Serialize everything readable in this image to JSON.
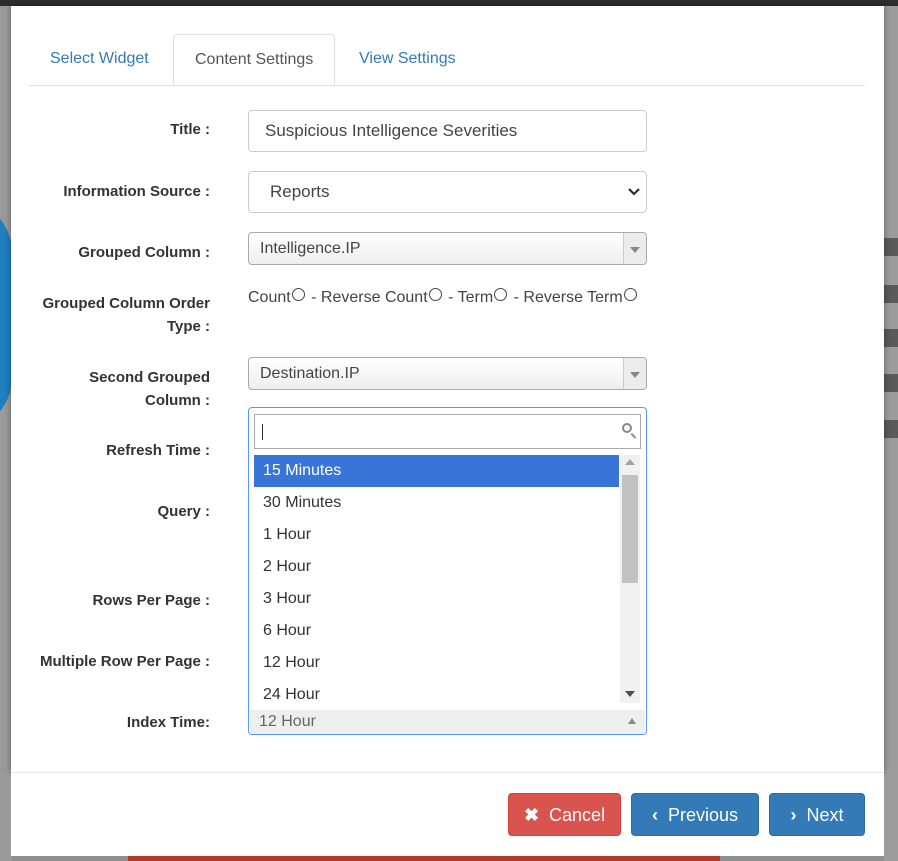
{
  "tabs": [
    "Select Widget",
    "Content Settings",
    "View Settings"
  ],
  "form": {
    "title_label": "Title :",
    "title_value": "Suspicious Intelligence Severities",
    "info_source_label": "Information Source :",
    "info_source_value": "Reports",
    "grouped_column_label": "Grouped Column :",
    "grouped_column_value": "Intelligence.IP",
    "order_type_label_1": "Grouped Column Order",
    "order_type_label_2": "Type :",
    "order_options": [
      "Count",
      "- Reverse Count",
      "- Term",
      "- Reverse Term"
    ],
    "second_grouped_label_1": "Second Grouped",
    "second_grouped_label_2": "Column :",
    "second_grouped_value": "Destination.IP",
    "refresh_time_label": "Refresh Time :",
    "query_label": "Query :",
    "rows_per_page_label": "Rows Per Page :",
    "multiple_row_label": "Multiple Row Per Page :",
    "index_time_label": "Index Time:",
    "index_time_value": "12 Hour"
  },
  "dropdown": {
    "search_value": "",
    "options": [
      "15 Minutes",
      "30 Minutes",
      "1 Hour",
      "2 Hour",
      "3 Hour",
      "6 Hour",
      "12 Hour",
      "24 Hour"
    ],
    "highlighted": "15 Minutes"
  },
  "footer": {
    "cancel": "Cancel",
    "previous": "Previous",
    "next": "Next"
  },
  "colors": {
    "primary": "#337ab7",
    "danger": "#d9534f",
    "highlight": "#3875d7"
  }
}
